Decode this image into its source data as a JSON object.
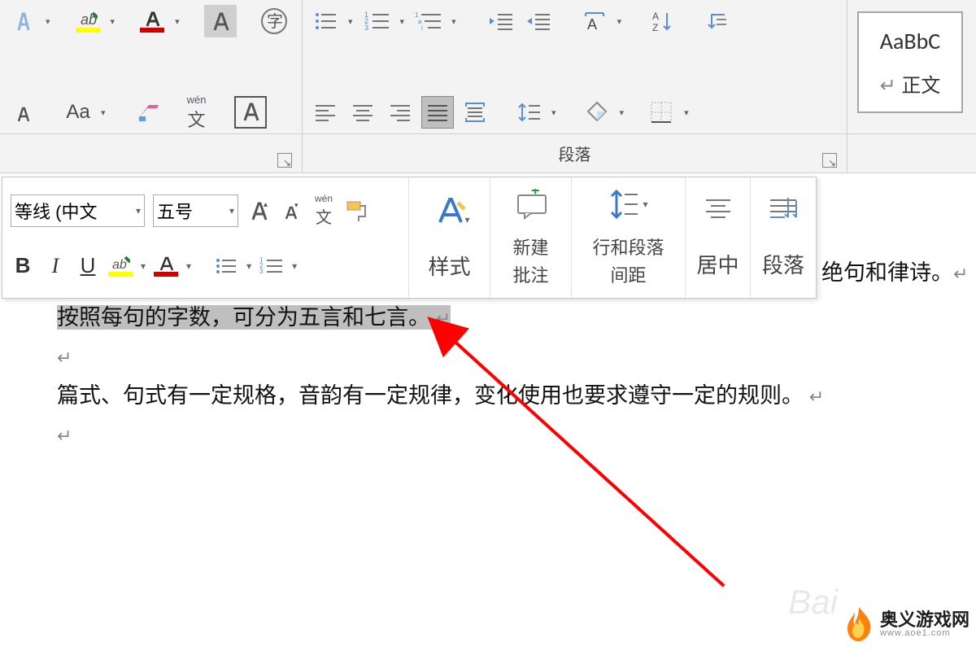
{
  "ribbon": {
    "paragraph_label": "段落",
    "phonetic_label": "wén",
    "font_name": "等线 (中文",
    "font_size": "五号"
  },
  "styles_gallery": {
    "sample": "AaBbC",
    "name": "正文"
  },
  "mini_toolbar": {
    "phonetic_label": "wén",
    "styles_label": "样式",
    "new_comment_line1": "新建",
    "new_comment_line2": "批注",
    "line_spacing_line1": "行和段落",
    "line_spacing_line2": "间距",
    "center_label": "居中",
    "paragraph_label": "段落"
  },
  "document": {
    "selected_text": "按照每句的字数，可分为五言和七言。",
    "para2": "篇式、句式有一定规格，音韵有一定规律，变化使用也要求遵守一定的规则。",
    "behind_fragment": "绝句和律诗。",
    "return_mark": "↵"
  },
  "watermark": {
    "faint": "Bai",
    "title": "奥义游戏网",
    "url": "www.aoe1.com"
  }
}
